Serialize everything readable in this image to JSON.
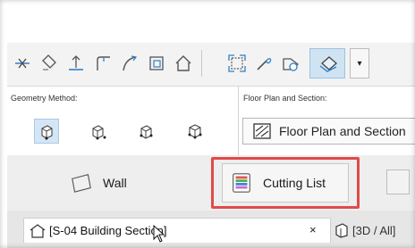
{
  "toolbar": {
    "icons": [
      "split-icon",
      "gravity-icon",
      "trim-icon",
      "fillet-icon",
      "curve-icon",
      "offset-icon",
      "roof-icon",
      "element-snap-icon",
      "magic-wand-icon",
      "label-icon",
      "cutting-plane-icon",
      "dropdown-icon"
    ],
    "dropdown_glyph": "▾"
  },
  "panel": {
    "geometry_label": "Geometry Method:",
    "floorplan_label": "Floor Plan and Section:",
    "floorplan_value": "Floor Plan and Section",
    "geometry_methods": [
      "single-geometry-icon",
      "dimensioned-geometry-icon",
      "extended-geometry-icon",
      "rotated-geometry-icon"
    ]
  },
  "elements": {
    "wall_label": "Wall",
    "cutting_list_label": "Cutting List"
  },
  "tabs": {
    "active_label": "[S-04 Building Section]",
    "close_glyph": "×",
    "second_label": "[3D / All]"
  },
  "colors": {
    "highlight_border": "#e04a4a",
    "selected_bg": "#d4e6f5",
    "accent_blue": "#2f7fc6"
  }
}
